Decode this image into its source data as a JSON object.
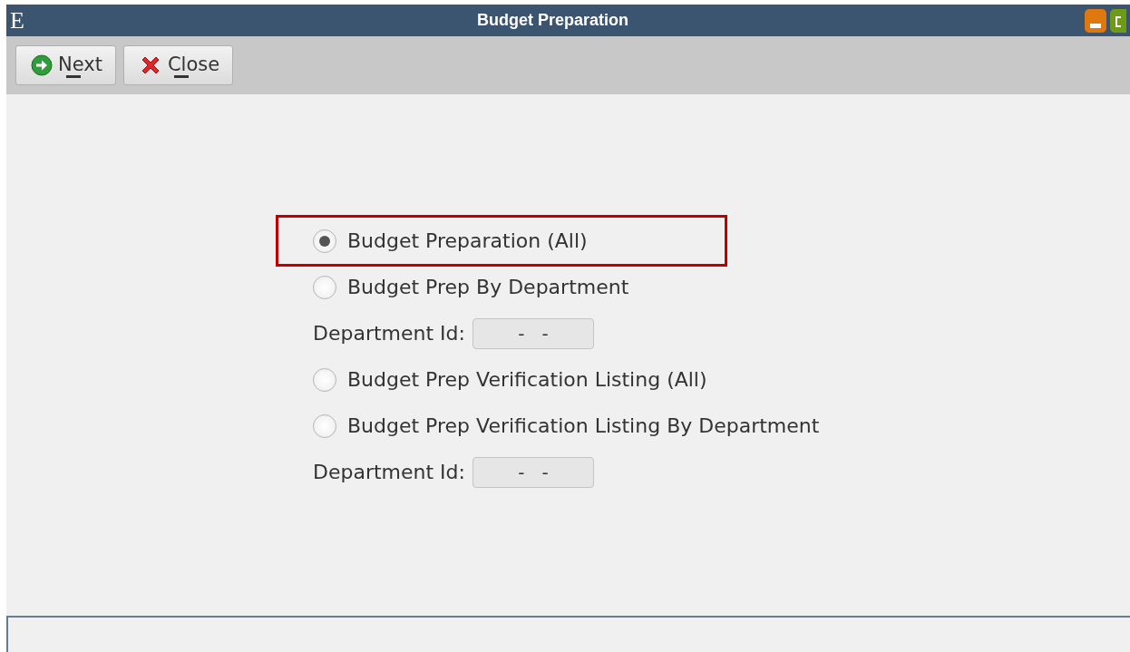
{
  "window": {
    "app_letter": "E",
    "title": "Budget Preparation"
  },
  "toolbar": [
    {
      "label": "Next",
      "kind": "next"
    },
    {
      "label": "Close",
      "kind": "close"
    }
  ],
  "options": [
    {
      "label": "Budget Preparation (All)",
      "selected": true,
      "highlighted": true
    },
    {
      "label": "Budget Prep By Department",
      "selected": false,
      "highlighted": false,
      "field": {
        "label": "Department Id:",
        "value": "-   -"
      }
    },
    {
      "label": "Budget Prep Verification Listing (All)",
      "selected": false,
      "highlighted": false
    },
    {
      "label": "Budget Prep Verification Listing By Department",
      "selected": false,
      "highlighted": false,
      "field": {
        "label": "Department Id:",
        "value": "-   -"
      }
    }
  ]
}
